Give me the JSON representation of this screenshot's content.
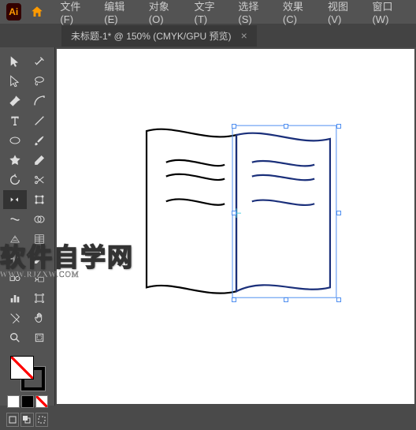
{
  "app": {
    "short": "Ai"
  },
  "menu": {
    "file": "文件(F)",
    "edit": "编辑(E)",
    "object": "对象(O)",
    "type": "文字(T)",
    "select": "选择(S)",
    "effect": "效果(C)",
    "view": "视图(V)",
    "window": "窗口(W)"
  },
  "tab": {
    "title": "未标题-1* @ 150% (CMYK/GPU 预览)",
    "close": "×"
  },
  "watermark": {
    "cn": "软件自学网",
    "en": "WWW.RJZXW.COM"
  },
  "colors": {
    "selection": "#4f8ff0",
    "stroke_left": "#000000",
    "stroke_right": "#1a2f7a"
  }
}
